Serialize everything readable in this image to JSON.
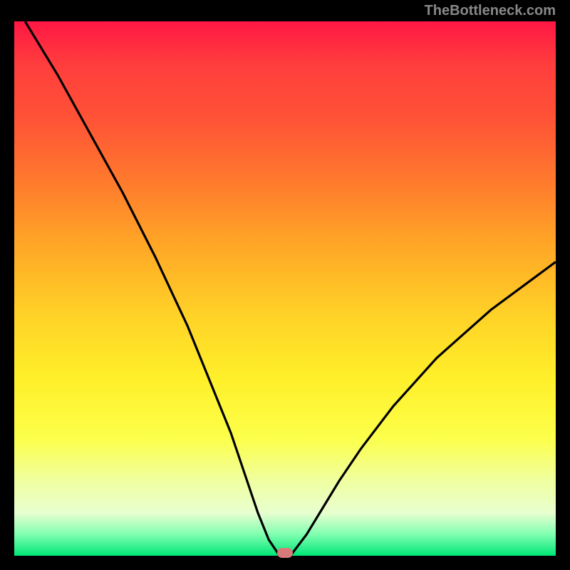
{
  "watermark": "TheBottleneck.com",
  "chart_data": {
    "type": "line",
    "title": "",
    "xlabel": "",
    "ylabel": "",
    "xlim": [
      0,
      100
    ],
    "ylim": [
      0,
      100
    ],
    "series": [
      {
        "name": "curve",
        "x": [
          2,
          8,
          14,
          20,
          26,
          32,
          36,
          40,
          43,
          45,
          47,
          49,
          50,
          51,
          54,
          57,
          60,
          64,
          70,
          78,
          88,
          100
        ],
        "y": [
          100,
          90,
          79,
          68,
          56,
          43,
          33,
          23,
          14,
          8,
          3,
          0,
          0,
          0,
          4,
          9,
          14,
          20,
          28,
          37,
          46,
          55
        ]
      }
    ],
    "marker": {
      "x": 50,
      "y": 0.5,
      "color": "#d97a7a"
    },
    "background_gradient": {
      "top": "#ff1744",
      "bottom": "#00e676"
    }
  }
}
